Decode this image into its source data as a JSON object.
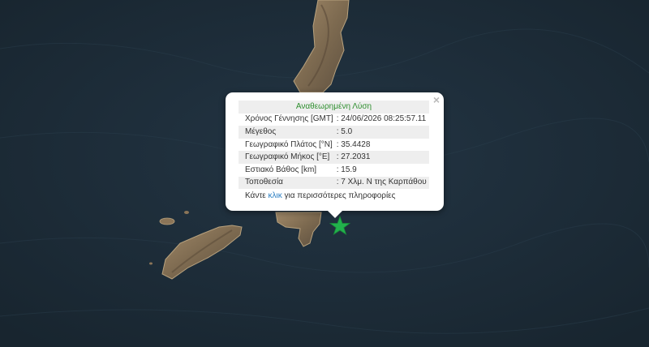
{
  "popup": {
    "title": "Αναθεωρημένη Λύση",
    "close_label": "×",
    "rows": [
      {
        "label": "Χρόνος Γέννησης [GMT]",
        "value": ": 24/06/2026 08:25:57.11"
      },
      {
        "label": "Μέγεθος",
        "value": ": 5.0"
      },
      {
        "label": "Γεωγραφικό Πλάτος [°N]",
        "value": ": 35.4428"
      },
      {
        "label": "Γεωγραφικό Μήκος [°E]",
        "value": ": 27.2031"
      },
      {
        "label": "Εστιακό Βάθος [km]",
        "value": ": 15.9"
      },
      {
        "label": "Τοποθεσία",
        "value": ": 7 Χλμ. Ν της Καρπάθου"
      }
    ],
    "more_prefix": "Κάντε ",
    "more_link": "κλικ",
    "more_suffix": " για περισσότερες πληροφορίες"
  },
  "marker": {
    "icon": "star-icon",
    "color": "#22b14c"
  },
  "colors": {
    "sea": "#1c2c39",
    "land": "#8b7558",
    "accent": "#2f8f2f",
    "link": "#2a7ec2"
  }
}
